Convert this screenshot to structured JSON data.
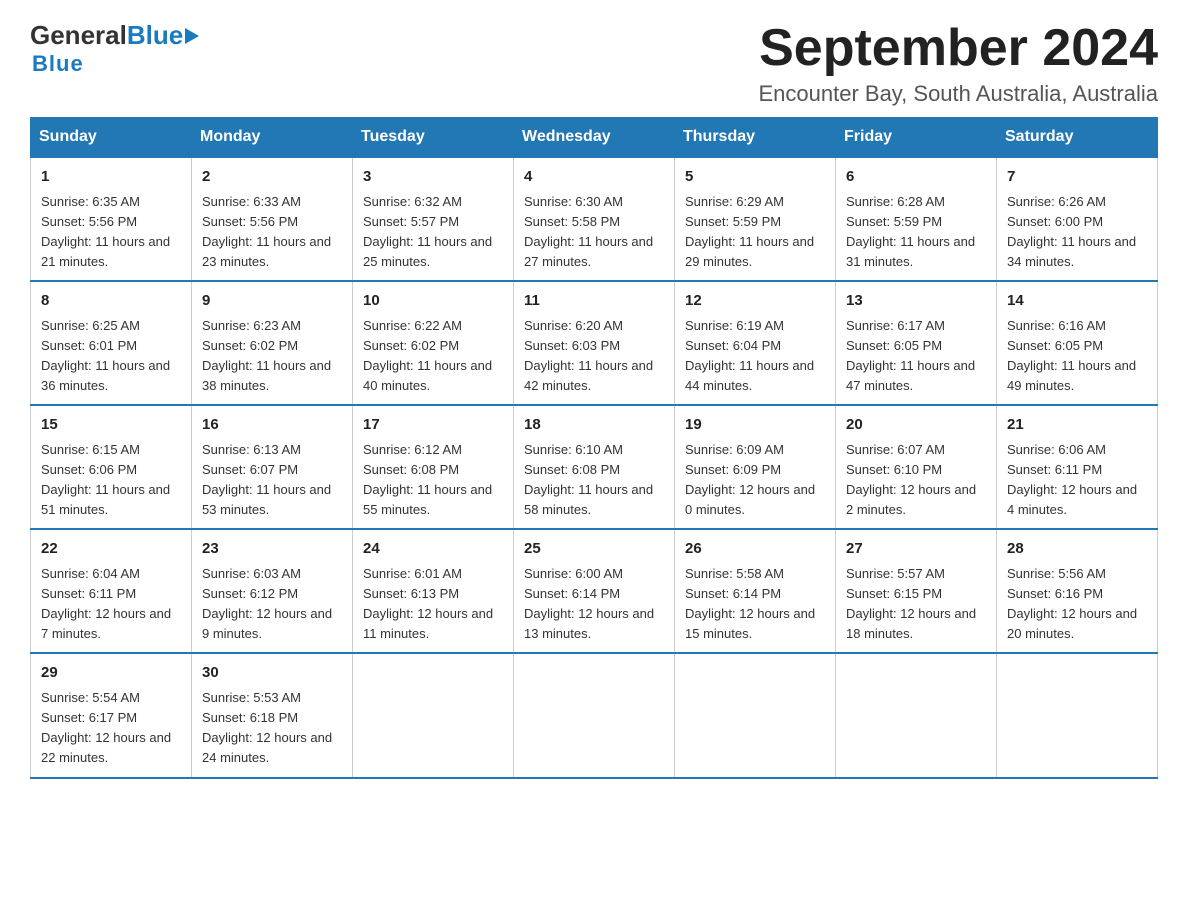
{
  "logo": {
    "general": "General",
    "blue": "Blue",
    "tagline": "Blue"
  },
  "title": "September 2024",
  "location": "Encounter Bay, South Australia, Australia",
  "headers": [
    "Sunday",
    "Monday",
    "Tuesday",
    "Wednesday",
    "Thursday",
    "Friday",
    "Saturday"
  ],
  "weeks": [
    [
      {
        "day": "1",
        "sunrise": "6:35 AM",
        "sunset": "5:56 PM",
        "daylight": "11 hours and 21 minutes."
      },
      {
        "day": "2",
        "sunrise": "6:33 AM",
        "sunset": "5:56 PM",
        "daylight": "11 hours and 23 minutes."
      },
      {
        "day": "3",
        "sunrise": "6:32 AM",
        "sunset": "5:57 PM",
        "daylight": "11 hours and 25 minutes."
      },
      {
        "day": "4",
        "sunrise": "6:30 AM",
        "sunset": "5:58 PM",
        "daylight": "11 hours and 27 minutes."
      },
      {
        "day": "5",
        "sunrise": "6:29 AM",
        "sunset": "5:59 PM",
        "daylight": "11 hours and 29 minutes."
      },
      {
        "day": "6",
        "sunrise": "6:28 AM",
        "sunset": "5:59 PM",
        "daylight": "11 hours and 31 minutes."
      },
      {
        "day": "7",
        "sunrise": "6:26 AM",
        "sunset": "6:00 PM",
        "daylight": "11 hours and 34 minutes."
      }
    ],
    [
      {
        "day": "8",
        "sunrise": "6:25 AM",
        "sunset": "6:01 PM",
        "daylight": "11 hours and 36 minutes."
      },
      {
        "day": "9",
        "sunrise": "6:23 AM",
        "sunset": "6:02 PM",
        "daylight": "11 hours and 38 minutes."
      },
      {
        "day": "10",
        "sunrise": "6:22 AM",
        "sunset": "6:02 PM",
        "daylight": "11 hours and 40 minutes."
      },
      {
        "day": "11",
        "sunrise": "6:20 AM",
        "sunset": "6:03 PM",
        "daylight": "11 hours and 42 minutes."
      },
      {
        "day": "12",
        "sunrise": "6:19 AM",
        "sunset": "6:04 PM",
        "daylight": "11 hours and 44 minutes."
      },
      {
        "day": "13",
        "sunrise": "6:17 AM",
        "sunset": "6:05 PM",
        "daylight": "11 hours and 47 minutes."
      },
      {
        "day": "14",
        "sunrise": "6:16 AM",
        "sunset": "6:05 PM",
        "daylight": "11 hours and 49 minutes."
      }
    ],
    [
      {
        "day": "15",
        "sunrise": "6:15 AM",
        "sunset": "6:06 PM",
        "daylight": "11 hours and 51 minutes."
      },
      {
        "day": "16",
        "sunrise": "6:13 AM",
        "sunset": "6:07 PM",
        "daylight": "11 hours and 53 minutes."
      },
      {
        "day": "17",
        "sunrise": "6:12 AM",
        "sunset": "6:08 PM",
        "daylight": "11 hours and 55 minutes."
      },
      {
        "day": "18",
        "sunrise": "6:10 AM",
        "sunset": "6:08 PM",
        "daylight": "11 hours and 58 minutes."
      },
      {
        "day": "19",
        "sunrise": "6:09 AM",
        "sunset": "6:09 PM",
        "daylight": "12 hours and 0 minutes."
      },
      {
        "day": "20",
        "sunrise": "6:07 AM",
        "sunset": "6:10 PM",
        "daylight": "12 hours and 2 minutes."
      },
      {
        "day": "21",
        "sunrise": "6:06 AM",
        "sunset": "6:11 PM",
        "daylight": "12 hours and 4 minutes."
      }
    ],
    [
      {
        "day": "22",
        "sunrise": "6:04 AM",
        "sunset": "6:11 PM",
        "daylight": "12 hours and 7 minutes."
      },
      {
        "day": "23",
        "sunrise": "6:03 AM",
        "sunset": "6:12 PM",
        "daylight": "12 hours and 9 minutes."
      },
      {
        "day": "24",
        "sunrise": "6:01 AM",
        "sunset": "6:13 PM",
        "daylight": "12 hours and 11 minutes."
      },
      {
        "day": "25",
        "sunrise": "6:00 AM",
        "sunset": "6:14 PM",
        "daylight": "12 hours and 13 minutes."
      },
      {
        "day": "26",
        "sunrise": "5:58 AM",
        "sunset": "6:14 PM",
        "daylight": "12 hours and 15 minutes."
      },
      {
        "day": "27",
        "sunrise": "5:57 AM",
        "sunset": "6:15 PM",
        "daylight": "12 hours and 18 minutes."
      },
      {
        "day": "28",
        "sunrise": "5:56 AM",
        "sunset": "6:16 PM",
        "daylight": "12 hours and 20 minutes."
      }
    ],
    [
      {
        "day": "29",
        "sunrise": "5:54 AM",
        "sunset": "6:17 PM",
        "daylight": "12 hours and 22 minutes."
      },
      {
        "day": "30",
        "sunrise": "5:53 AM",
        "sunset": "6:18 PM",
        "daylight": "12 hours and 24 minutes."
      },
      null,
      null,
      null,
      null,
      null
    ]
  ]
}
